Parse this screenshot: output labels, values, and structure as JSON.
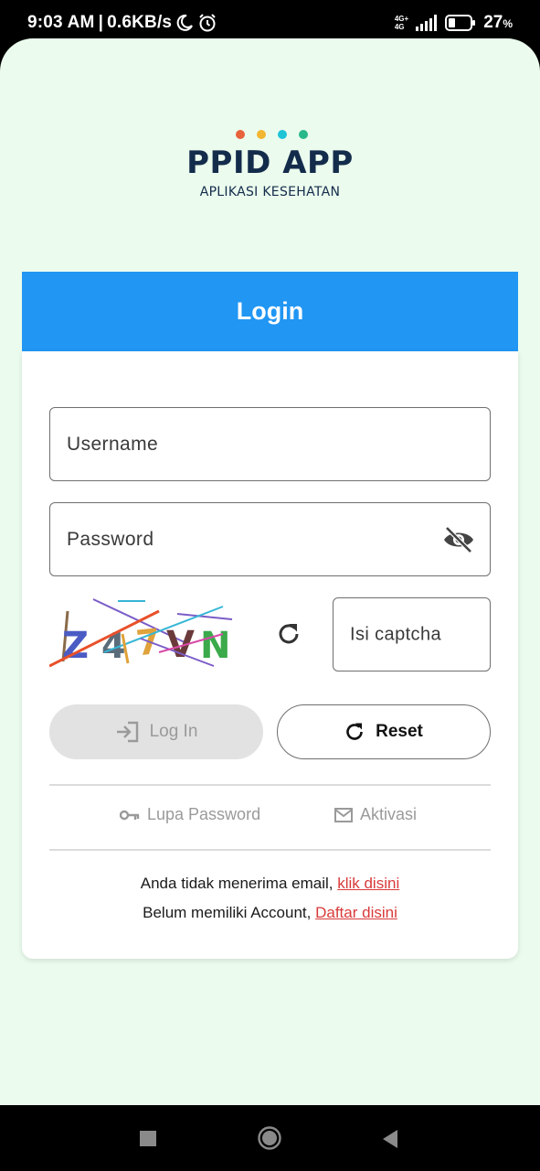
{
  "status_bar": {
    "time": "9:03 AM",
    "separator": "|",
    "speed": "0.6KB/s",
    "network_top": "4G+",
    "network_bottom": "4G",
    "battery": "27",
    "battery_unit": "%"
  },
  "logo": {
    "title": "PPID APP",
    "subtitle": "APLIKASI KESEHATAN",
    "dot_colors": [
      "#e8623c",
      "#f2b632",
      "#1fc4d6",
      "#2ab88a"
    ]
  },
  "login": {
    "header": "Login",
    "username_label": "Username",
    "password_label": "Password",
    "captcha_label": "Isi captcha",
    "captcha_chars": [
      "Z",
      "4",
      "7",
      "V",
      "N"
    ],
    "login_button": "Log In",
    "reset_button": "Reset",
    "forgot_password": "Lupa Password",
    "activation": "Aktivasi",
    "no_email_text": "Anda tidak menerima email, ",
    "no_email_link": "klik disini",
    "no_account_text": "Belum memiliki Account, ",
    "no_account_link": "Daftar disini"
  },
  "colors": {
    "background": "#ebfcee",
    "header": "#2196f3",
    "link": "#d93a3a",
    "brand_text": "#142c4b"
  },
  "icons": [
    "moon-icon",
    "alarm-icon",
    "signal-icon",
    "battery-icon",
    "eye-off-icon",
    "refresh-icon",
    "login-icon",
    "key-icon",
    "mail-icon",
    "nav-recents-icon",
    "nav-home-icon",
    "nav-back-icon"
  ]
}
